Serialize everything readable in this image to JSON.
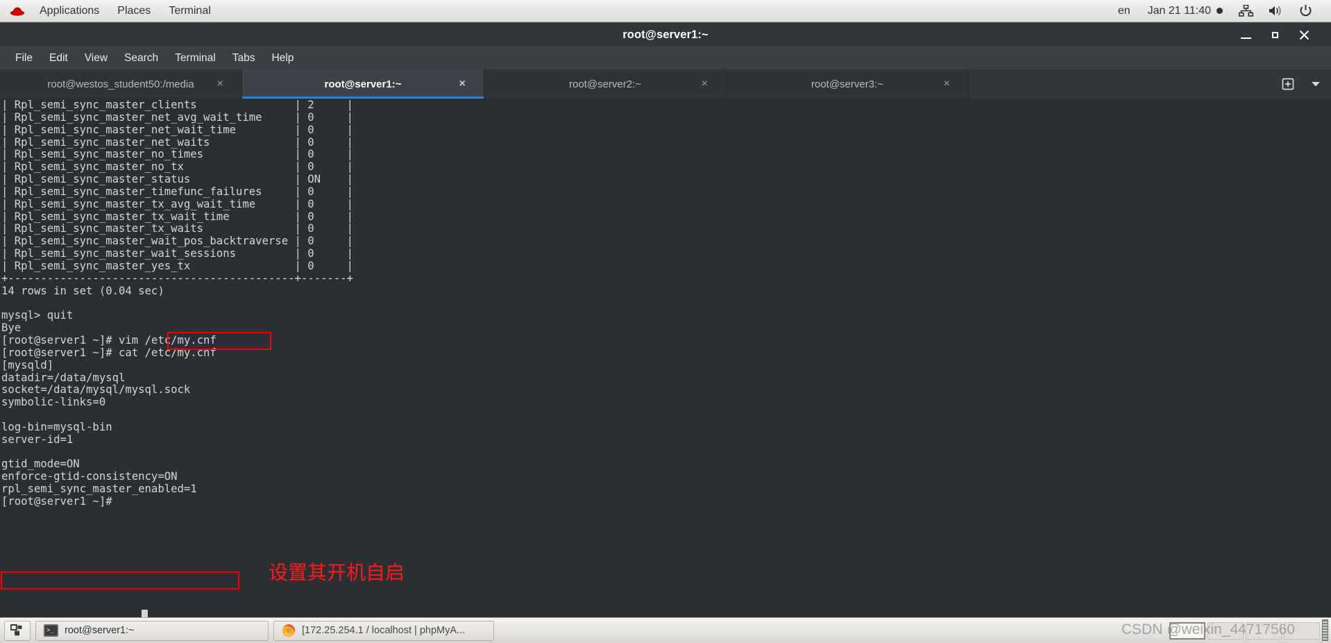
{
  "panel": {
    "logo_icon": "redhat-logo",
    "menus": [
      "Applications",
      "Places",
      "Terminal"
    ],
    "language": "en",
    "clock": "Jan 21  11:40",
    "indicator_icon": "recording-dot-icon",
    "icons": [
      "network-icon",
      "volume-icon",
      "power-icon"
    ]
  },
  "window": {
    "title": "root@server1:~",
    "controls": {
      "minimize": "minimize-icon",
      "maximize": "maximize-icon",
      "close": "close-icon"
    },
    "menubar": [
      "File",
      "Edit",
      "View",
      "Search",
      "Terminal",
      "Tabs",
      "Help"
    ],
    "tabs": [
      {
        "label": "root@westos_student50:/media",
        "active": false,
        "close": "×"
      },
      {
        "label": "root@server1:~",
        "active": true,
        "close": "×"
      },
      {
        "label": "root@server2:~",
        "active": false,
        "close": "×"
      },
      {
        "label": "root@server3:~",
        "active": false,
        "close": "×"
      }
    ],
    "tab_actions": {
      "new_tab_icon": "new-tab-icon",
      "tab_list_icon": "chevron-down-icon"
    },
    "accent_color": "#2a7fd4"
  },
  "terminal": {
    "prompt": "[root@server1 ~]#",
    "content": "| Rpl_semi_sync_master_clients               | 2     |\n| Rpl_semi_sync_master_net_avg_wait_time     | 0     |\n| Rpl_semi_sync_master_net_wait_time         | 0     |\n| Rpl_semi_sync_master_net_waits             | 0     |\n| Rpl_semi_sync_master_no_times              | 0     |\n| Rpl_semi_sync_master_no_tx                 | 0     |\n| Rpl_semi_sync_master_status                | ON    |\n| Rpl_semi_sync_master_timefunc_failures     | 0     |\n| Rpl_semi_sync_master_tx_avg_wait_time      | 0     |\n| Rpl_semi_sync_master_tx_wait_time          | 0     |\n| Rpl_semi_sync_master_tx_waits              | 0     |\n| Rpl_semi_sync_master_wait_pos_backtraverse | 0     |\n| Rpl_semi_sync_master_wait_sessions         | 0     |\n| Rpl_semi_sync_master_yes_tx                | 0     |\n+--------------------------------------------+-------+\n14 rows in set (0.04 sec)\n\nmysql> quit\nBye\n[root@server1 ~]# vim /etc/my.cnf\n[root@server1 ~]# cat /etc/my.cnf\n[mysqld]\ndatadir=/data/mysql\nsocket=/data/mysql/mysql.sock\nsymbolic-links=0\n\nlog-bin=mysql-bin\nserver-id=1\n\ngtid_mode=ON\nenforce-gtid-consistency=ON\nrpl_semi_sync_master_enabled=1\n[root@server1 ~]# "
  },
  "annotations": {
    "highlight_color": "#ff0000",
    "boxes": [
      {
        "name": "config-path-highlight",
        "text": "/etc/my.cnf"
      },
      {
        "name": "rpl-semi-sync-highlight",
        "text": "rpl_semi_sync_master_enabled=1"
      }
    ],
    "note": "设置其开机自启"
  },
  "taskbar": {
    "workspace_icon": "workspace-switcher-icon",
    "items": [
      {
        "label": "root@server1:~",
        "icon": "terminal-icon"
      },
      {
        "label": "[172.25.254.1 / localhost | phpMyA...",
        "icon": "firefox-icon"
      }
    ],
    "watermark": "CSDN @weixin_44717560"
  }
}
